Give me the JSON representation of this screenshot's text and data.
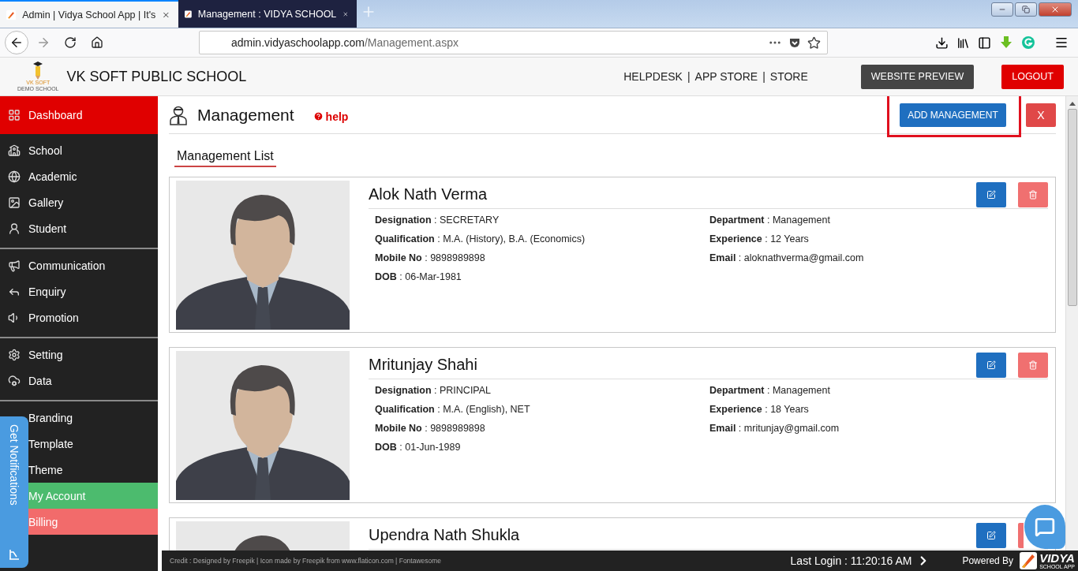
{
  "browser": {
    "tabs": [
      {
        "title": "Admin | Vidya School App | It's",
        "selected": false
      },
      {
        "title": "Management : VIDYA SCHOOL",
        "selected": true
      }
    ],
    "url": {
      "domain": "admin.vidyaschoolapp.com",
      "path": "/Management.aspx"
    }
  },
  "header": {
    "logo_line1": "VK SOFT",
    "logo_line2": "DEMO SCHOOL",
    "school_name": "VK SOFT PUBLIC SCHOOL",
    "links": [
      "HELPDESK",
      "APP STORE",
      "STORE"
    ],
    "separator": "|",
    "preview_button": "WEBSITE PREVIEW",
    "logout_button": "LOGOUT"
  },
  "sidebar": {
    "groups": [
      [
        {
          "label": "Dashboard",
          "selected": true
        }
      ],
      [
        {
          "label": "School",
          "selected": false
        },
        {
          "label": "Academic",
          "selected": false
        },
        {
          "label": "Gallery",
          "selected": false
        },
        {
          "label": "Student",
          "selected": false
        }
      ],
      [
        {
          "label": "Communication",
          "selected": false
        },
        {
          "label": "Enquiry",
          "selected": false
        },
        {
          "label": "Promotion",
          "selected": false
        }
      ],
      [
        {
          "label": "Setting",
          "selected": false
        },
        {
          "label": "Data",
          "selected": false
        }
      ],
      [
        {
          "label": "Branding",
          "selected": false
        },
        {
          "label": "Template",
          "selected": false
        },
        {
          "label": "Theme",
          "selected": false
        },
        {
          "label": "My Account",
          "selected": false,
          "color": "#4cbb6e"
        },
        {
          "label": "Billing",
          "selected": false,
          "color": "#f26b6b"
        }
      ]
    ]
  },
  "notifications_tab": "Get Notifications",
  "field_separator": ":",
  "page": {
    "title": "Management",
    "help": "help",
    "add_button": "ADD MANAGEMENT",
    "close_button": "X",
    "list_title": "Management List"
  },
  "members": [
    {
      "name": "Alok Nath Verma",
      "left_fields": [
        {
          "label": "Designation",
          "value": "SECRETARY"
        },
        {
          "label": "Qualification",
          "value": "M.A. (History), B.A. (Economics)"
        },
        {
          "label": "Mobile No",
          "value": "9898989898"
        },
        {
          "label": "DOB",
          "value": "06-Mar-1981"
        }
      ],
      "right_fields": [
        {
          "label": "Department",
          "value": "Management"
        },
        {
          "label": "Experience",
          "value": "12 Years"
        },
        {
          "label": "Email",
          "value": "aloknathverma@gmail.com"
        }
      ]
    },
    {
      "name": "Mritunjay Shahi",
      "left_fields": [
        {
          "label": "Designation",
          "value": "PRINCIPAL"
        },
        {
          "label": "Qualification",
          "value": "M.A. (English), NET"
        },
        {
          "label": "Mobile No",
          "value": "9898989898"
        },
        {
          "label": "DOB",
          "value": "01-Jun-1989"
        }
      ],
      "right_fields": [
        {
          "label": "Department",
          "value": "Management"
        },
        {
          "label": "Experience",
          "value": "18 Years"
        },
        {
          "label": "Email",
          "value": "mritunjay@gmail.com"
        }
      ]
    },
    {
      "name": "Upendra Nath Shukla"
    }
  ],
  "footer": {
    "credit": "Credit : Designed by Freepik | Icon made by Freepik from www.flaticon.com | Fontawesome",
    "last_login": "Last Login : 11:20:16 AM",
    "powered_by": "Powered By",
    "brand": "VIDYA",
    "brand_sub": "SCHOOL APP"
  }
}
